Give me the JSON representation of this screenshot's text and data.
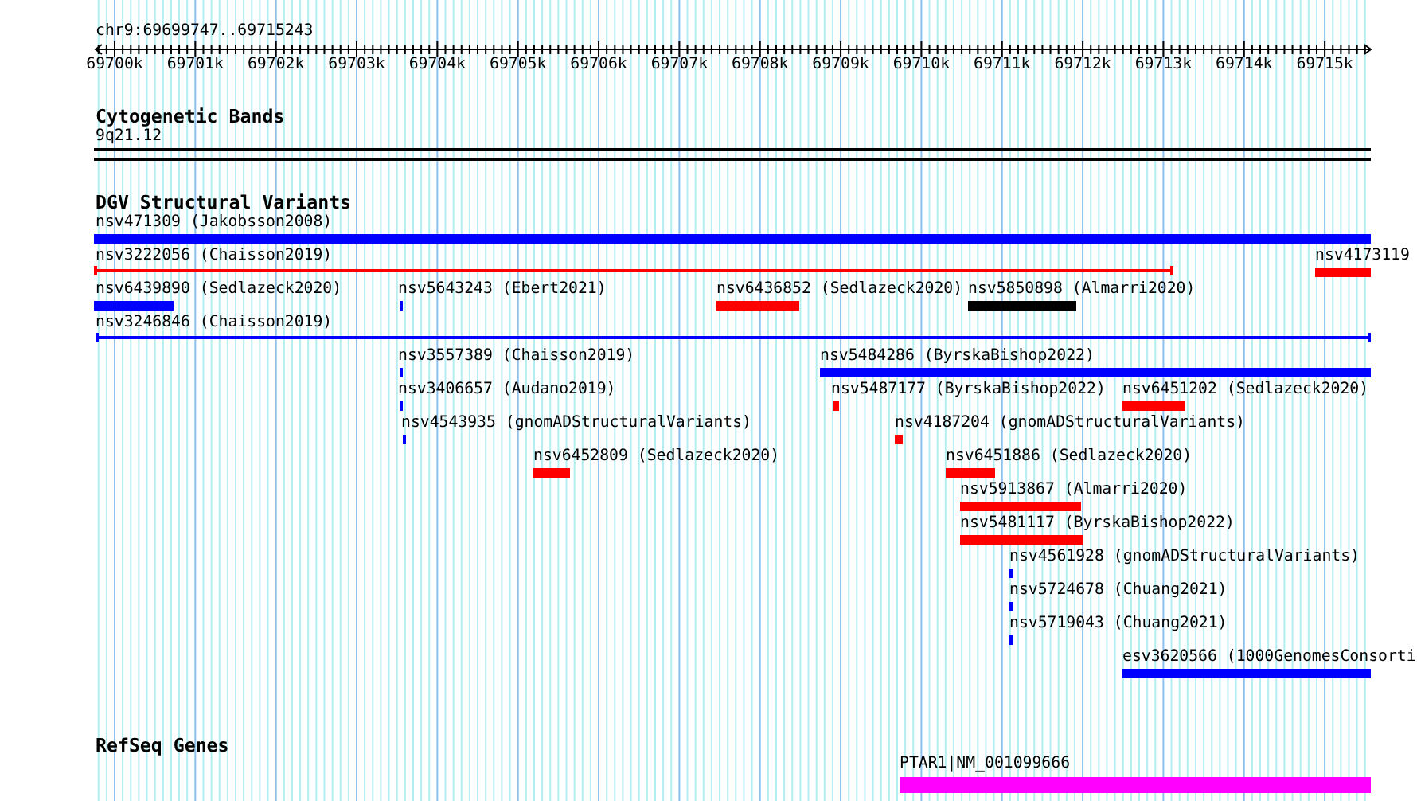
{
  "ruler": {
    "location": "chr9:69699747..69715243",
    "ticks": [
      "69700k",
      "69701k",
      "69702k",
      "69703k",
      "69704k",
      "69705k",
      "69706k",
      "69707k",
      "69708k",
      "69709k",
      "69710k",
      "69711k",
      "69712k",
      "69713k",
      "69714k",
      "69715k"
    ]
  },
  "tracks": [
    {
      "title": "Cytogenetic Bands",
      "features": [
        {
          "label": "9q21.12",
          "kind": "band",
          "color": "#000000"
        }
      ]
    },
    {
      "title": "DGV Structural Variants",
      "features": [
        {
          "label": "nsv471309 (Jakobsson2008)",
          "kind": "bar",
          "color": "#0000ff"
        },
        {
          "label": "nsv3222056 (Chaisson2019)",
          "kind": "line",
          "color": "#ff0000"
        },
        {
          "label": "nsv4173119",
          "kind": "bar",
          "color": "#ff0000"
        },
        {
          "label": "nsv6439890 (Sedlazeck2020)",
          "kind": "bar",
          "color": "#0000ff"
        },
        {
          "label": "nsv5643243 (Ebert2021)",
          "kind": "bar",
          "color": "#0000ff"
        },
        {
          "label": "nsv6436852 (Sedlazeck2020)",
          "kind": "bar",
          "color": "#ff0000"
        },
        {
          "label": "nsv5850898 (Almarri2020)",
          "kind": "bar",
          "color": "#000000"
        },
        {
          "label": "nsv3246846 (Chaisson2019)",
          "kind": "line",
          "color": "#0000ff"
        },
        {
          "label": "nsv3557389 (Chaisson2019)",
          "kind": "bar",
          "color": "#0000ff"
        },
        {
          "label": "nsv5484286 (ByrskaBishop2022)",
          "kind": "bar",
          "color": "#0000ff"
        },
        {
          "label": "nsv3406657 (Audano2019)",
          "kind": "bar",
          "color": "#0000ff"
        },
        {
          "label": "nsv5487177 (ByrskaBishop2022)",
          "kind": "bar",
          "color": "#ff0000"
        },
        {
          "label": "nsv6451202 (Sedlazeck2020)",
          "kind": "bar",
          "color": "#ff0000"
        },
        {
          "label": "nsv4543935 (gnomADStructuralVariants)",
          "kind": "bar",
          "color": "#0000ff"
        },
        {
          "label": "nsv4187204 (gnomADStructuralVariants)",
          "kind": "bar",
          "color": "#ff0000"
        },
        {
          "label": "nsv6452809 (Sedlazeck2020)",
          "kind": "bar",
          "color": "#ff0000"
        },
        {
          "label": "nsv6451886 (Sedlazeck2020)",
          "kind": "bar",
          "color": "#ff0000"
        },
        {
          "label": "nsv5913867 (Almarri2020)",
          "kind": "bar",
          "color": "#ff0000"
        },
        {
          "label": "nsv5481117 (ByrskaBishop2022)",
          "kind": "bar",
          "color": "#ff0000"
        },
        {
          "label": "nsv4561928 (gnomADStructuralVariants)",
          "kind": "bar",
          "color": "#0000ff"
        },
        {
          "label": "nsv5724678 (Chuang2021)",
          "kind": "bar",
          "color": "#0000ff"
        },
        {
          "label": "nsv5719043 (Chuang2021)",
          "kind": "bar",
          "color": "#0000ff"
        },
        {
          "label": "esv3620566 (1000GenomesConsorti",
          "kind": "bar",
          "color": "#0000ff"
        }
      ]
    },
    {
      "title": "RefSeq Genes",
      "features": [
        {
          "label": "PTAR1|NM_001099666",
          "kind": "gene",
          "color": "#ff00ff"
        }
      ]
    }
  ]
}
